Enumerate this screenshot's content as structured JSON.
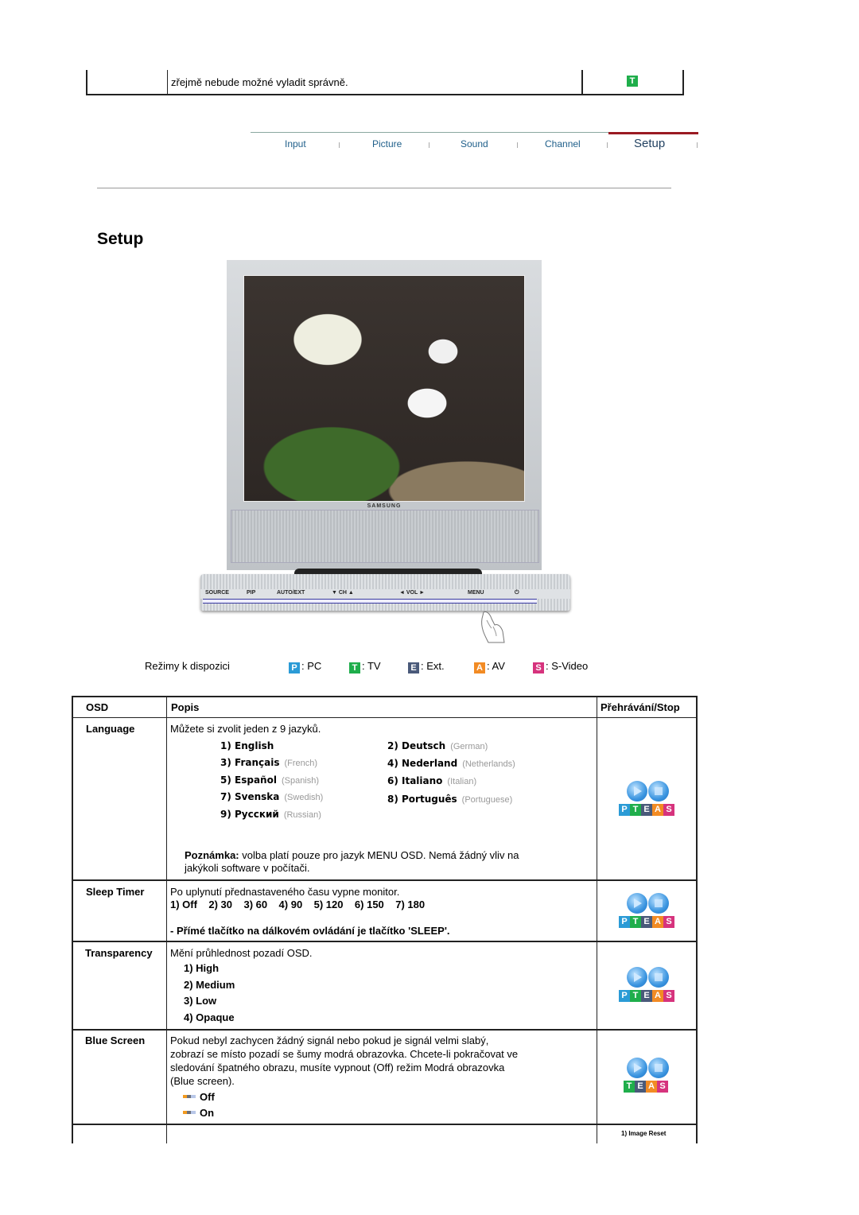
{
  "top_row": {
    "text": "zřejmě nebude možné vyladit správně.",
    "mode_badge": "T"
  },
  "nav": {
    "tabs": [
      {
        "label": "Input",
        "active": false
      },
      {
        "label": "Picture",
        "active": false
      },
      {
        "label": "Sound",
        "active": false
      },
      {
        "label": "Channel",
        "active": false
      },
      {
        "label": "Setup",
        "active": true
      }
    ],
    "active_color": "#9a1a22"
  },
  "page_title": "Setup",
  "monitor": {
    "brand": "SAMSUNG",
    "panel_labels": [
      "SOURCE",
      "PIP",
      "AUTO/EXT",
      "▼ CH ▲",
      "◄ VOL ►",
      "MENU",
      "⏻"
    ]
  },
  "modes": {
    "label": "Režimy k dispozici",
    "items": [
      {
        "badge": "P",
        "text": ": PC",
        "color": "#2b9bd6"
      },
      {
        "badge": "T",
        "text": ": TV",
        "color": "#1fae4b"
      },
      {
        "badge": "E",
        "text": ": Ext.",
        "color": "#4a5a7a"
      },
      {
        "badge": "A",
        "text": ": AV",
        "color": "#f28b24"
      },
      {
        "badge": "S",
        "text": ": S-Video",
        "color": "#d6337d"
      }
    ]
  },
  "table": {
    "headers": {
      "osd": "OSD",
      "desc": "Popis",
      "play": "Přehrávání/Stop"
    },
    "rows": [
      {
        "osd": "Language",
        "desc": "Můžete si zvolit jeden z 9 jazyků.",
        "languages": [
          {
            "name": "1) English",
            "en": ""
          },
          {
            "name": "2) Deutsch",
            "en": "(German)"
          },
          {
            "name": "3) Français",
            "en": "(French)"
          },
          {
            "name": "4) Nederland",
            "en": "(Netherlands)"
          },
          {
            "name": "5) Español",
            "en": "(Spanish)"
          },
          {
            "name": "6) Italiano",
            "en": "(Italian)"
          },
          {
            "name": "7) Svenska",
            "en": "(Swedish)"
          },
          {
            "name": "8) Português",
            "en": "(Portuguese)"
          },
          {
            "name": "9) Русский",
            "en": "(Russian)"
          }
        ],
        "note_label": "Poznámka:",
        "note_text": " volba platí pouze pro jazyk MENU OSD. Nemá žádný vliv na",
        "note_text2": "jakýkoli software v počítači.",
        "modes": [
          "P",
          "T",
          "E",
          "A",
          "S"
        ]
      },
      {
        "osd": "Sleep Timer",
        "desc": "Po uplynutí přednastaveného času vypne monitor.",
        "options": "1) Off    2) 30    3) 60    4) 90    5) 120    6) 150    7) 180",
        "hint": "- Přímé tlačítko na dálkovém ovládání je tlačítko 'SLEEP'.",
        "modes": [
          "P",
          "T",
          "E",
          "A",
          "S"
        ]
      },
      {
        "osd": "Transparency",
        "desc": "Mění průhlednost pozadí OSD.",
        "options": [
          "1) High",
          "2) Medium",
          "3) Low",
          "4) Opaque"
        ],
        "modes": [
          "P",
          "T",
          "E",
          "A",
          "S"
        ]
      },
      {
        "osd": "Blue Screen",
        "desc_lines": [
          "Pokud nebyl zachycen žádný signál nebo pokud je signál velmi slabý,",
          "zobrazí se místo pozadí se šumy modrá obrazovka. Chcete-li pokračovat ve",
          "sledování špatného obrazu, musíte vypnout (Off) režim Modrá obrazovka",
          "(Blue screen)."
        ],
        "options": [
          "Off",
          "On"
        ],
        "modes": [
          "T",
          "E",
          "A",
          "S"
        ]
      }
    ],
    "footnote": "1) Image Reset"
  }
}
